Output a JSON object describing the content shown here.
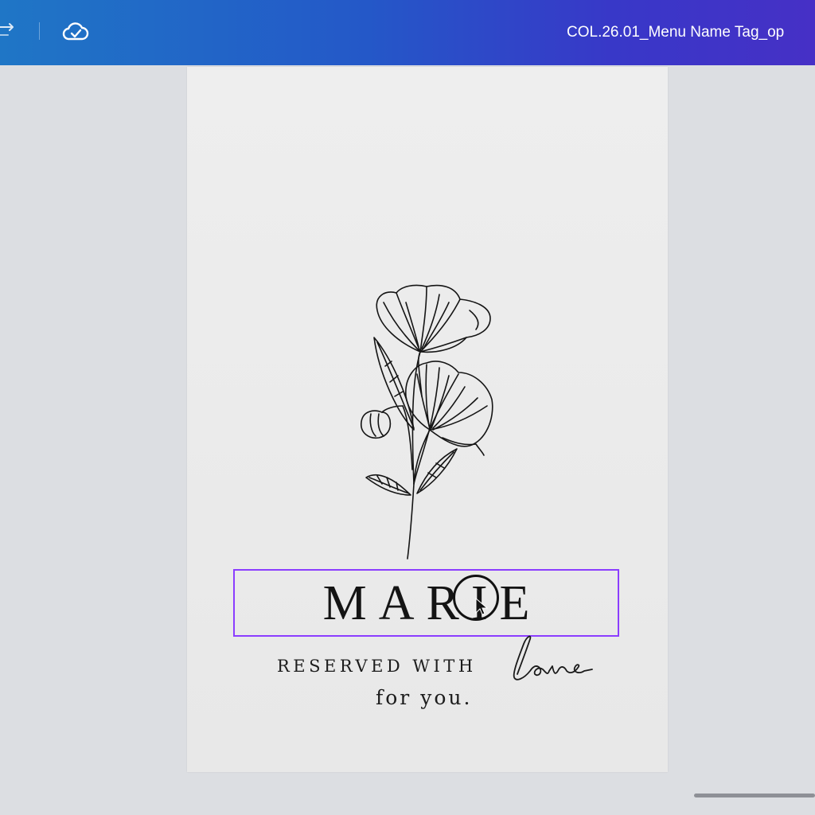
{
  "header": {
    "title": "COL.26.01_Menu Name Tag_op",
    "icons": [
      "redo-icon",
      "cloud-saved-icon"
    ]
  },
  "design": {
    "name": "MARIE",
    "reserved_line": "RESERVED WITH",
    "script_word": "love",
    "closing_line": "for you."
  },
  "colors": {
    "selection": "#8b3dff",
    "header_start": "#1f76c6",
    "header_end": "#4630c6"
  }
}
